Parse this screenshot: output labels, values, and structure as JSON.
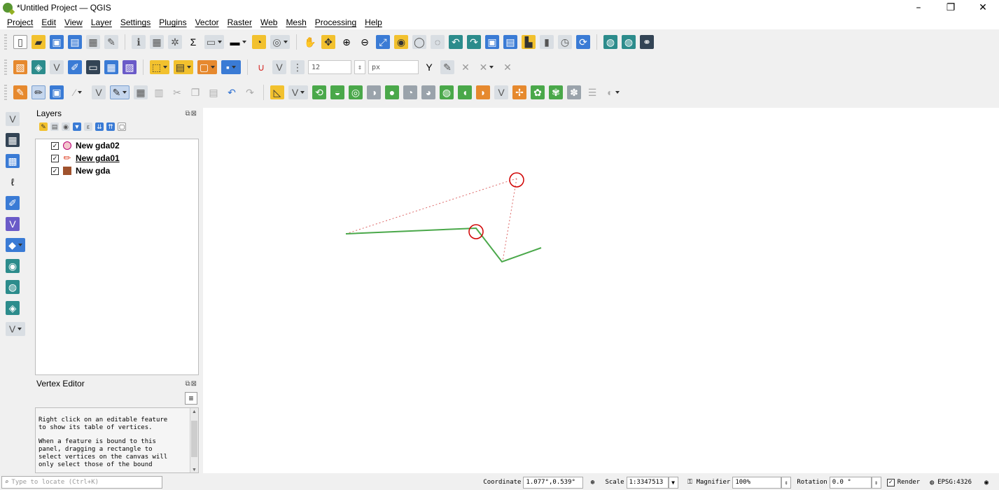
{
  "window": {
    "title": "*Untitled Project — QGIS",
    "minimize": "–",
    "restore": "❐",
    "close": "✕"
  },
  "menu": [
    "Project",
    "Edit",
    "View",
    "Layer",
    "Settings",
    "Plugins",
    "Vector",
    "Raster",
    "Web",
    "Mesh",
    "Processing",
    "Help"
  ],
  "snapping": {
    "tolerance": "12",
    "units": "px"
  },
  "layers_panel": {
    "title": "Layers",
    "layers": [
      {
        "name": "New gda02",
        "checked": "✓",
        "symbol": "point"
      },
      {
        "name": "New gda01",
        "checked": "✓",
        "symbol": "line",
        "active": true
      },
      {
        "name": "New gda",
        "checked": "✓",
        "symbol": "polygon"
      }
    ]
  },
  "vertex_panel": {
    "title": "Vertex Editor",
    "menu_icon": "≡",
    "text1": "Right click on an editable feature\nto show its table of vertices.",
    "text2": "When a feature is bound to this\npanel, dragging a rectangle to\nselect vertices on the canvas will\nonly select those of the bound"
  },
  "canvas": {
    "line_color": "#4aa84a",
    "rubberband_color": "#d66",
    "marker_color": "#d00000"
  },
  "status": {
    "locator_placeholder": "Type to locate (Ctrl+K)",
    "coordinate_label": "Coordinate",
    "coordinate_value": "1.077°,0.539°",
    "scale_label": "Scale",
    "scale_value": "1:3347513",
    "magnifier_label": "Magnifier",
    "magnifier_value": "100%",
    "rotation_label": "Rotation",
    "rotation_value": "0.0 °",
    "render_label": "Render",
    "render_checked": "✓",
    "crs": "EPSG:4326"
  }
}
